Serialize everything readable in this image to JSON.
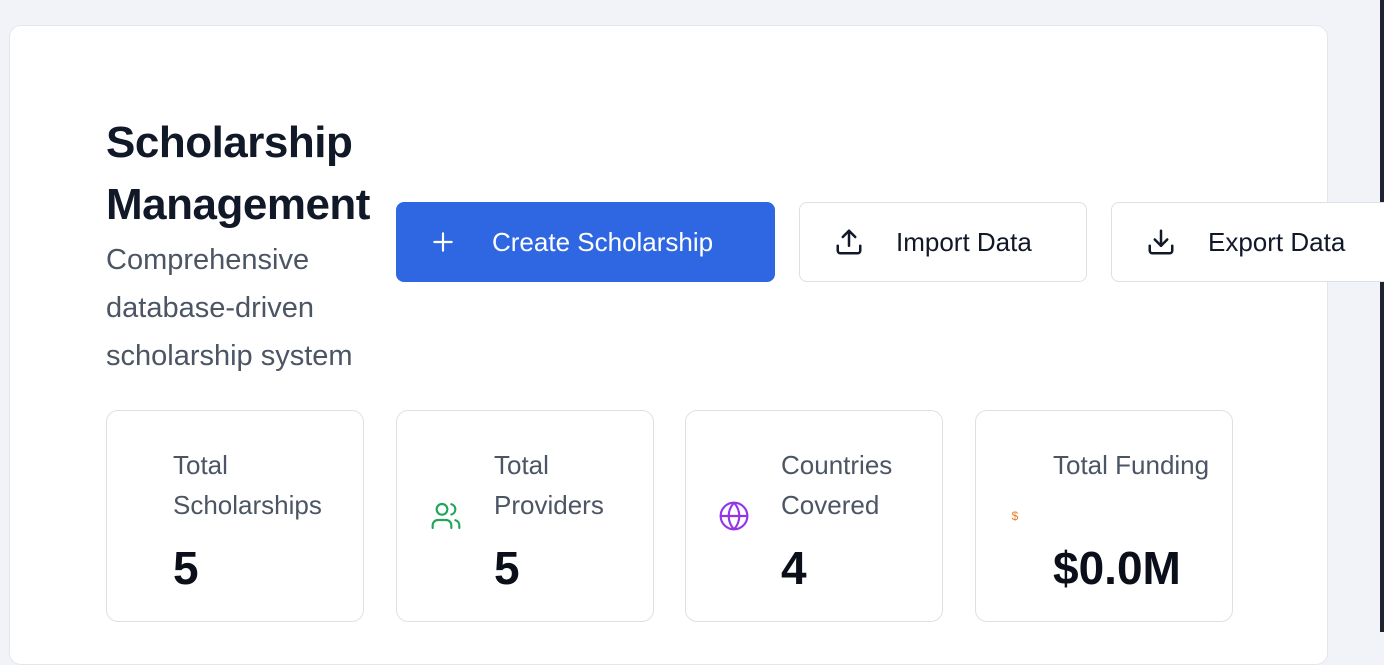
{
  "header": {
    "title": "Scholarship Management",
    "subtitle": "Comprehensive database-driven scholarship system"
  },
  "actions": {
    "create_label": "Create Scholarship",
    "import_label": "Import Data",
    "export_label": "Export Data"
  },
  "stats": [
    {
      "label": "Total Scholarships",
      "value": "5",
      "icon": "graduation-icon"
    },
    {
      "label": "Total Providers",
      "value": "5",
      "icon": "users-icon"
    },
    {
      "label": "Countries Covered",
      "value": "4",
      "icon": "globe-icon"
    },
    {
      "label": "Total Funding",
      "value": "$0.0M",
      "icon": "dollar-icon",
      "icon_text": "$"
    }
  ],
  "colors": {
    "primary": "#2f67e3",
    "users_icon": "#22a55a",
    "globe_icon": "#9333ea",
    "dollar_icon": "#ea7a26"
  }
}
